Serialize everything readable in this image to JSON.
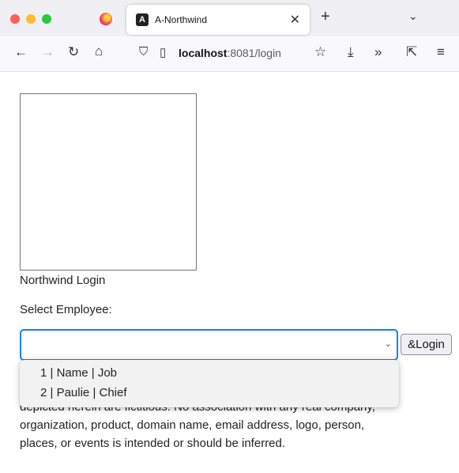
{
  "browser": {
    "tab_title": "A-Northwind",
    "tab_favicon_letter": "A",
    "tab_close": "✕",
    "new_tab": "+",
    "tabs_menu": "⌄",
    "url_host": "localhost",
    "url_rest": ":8081/login",
    "icons": {
      "back": "back-arrow-icon",
      "forward": "forward-arrow-icon",
      "reload": "reload-icon",
      "home": "home-icon",
      "shield": "tracking-protection-icon",
      "page": "page-info-icon",
      "bookmark": "bookmark-star-icon",
      "downloads": "download-icon",
      "overflow": "overflow-chevrons-icon",
      "share": "share-icon",
      "menu": "hamburger-menu-icon"
    }
  },
  "page": {
    "login_title": "Northwind Login",
    "select_label": "Select Employee:",
    "select_value": "",
    "login_button": "&Login",
    "disclaimer_visible": "depicted herein are fictitious. No association with any real company, organization, product, domain name, email address, logo, person, places, or events is intended or should be inferred."
  },
  "dropdown": {
    "options": [
      "1 | Name | Job",
      "2 | Paulie | Chief"
    ]
  },
  "colors": {
    "focus_border": "#0a84ff",
    "tabbar_bg": "#f0f0f4",
    "navbar_bg": "#f9f9fb"
  }
}
